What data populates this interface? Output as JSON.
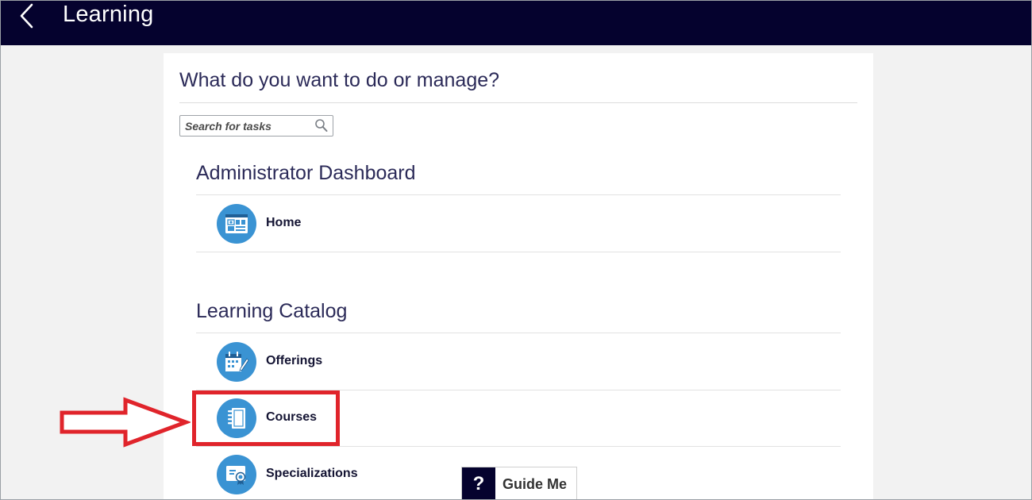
{
  "header": {
    "title": "Learning",
    "back_icon": "chevron-left-icon"
  },
  "main": {
    "question": "What do you want to do or manage?",
    "search": {
      "placeholder": "Search for tasks",
      "value": "",
      "icon": "search-icon"
    }
  },
  "sections": [
    {
      "title": "Administrator Dashboard",
      "items": [
        {
          "label": "Home",
          "icon": "dashboard-icon"
        }
      ]
    },
    {
      "title": "Learning Catalog",
      "items": [
        {
          "label": "Offerings",
          "icon": "calendar-edit-icon"
        },
        {
          "label": "Courses",
          "icon": "notebook-icon"
        },
        {
          "label": "Specializations",
          "icon": "certificate-icon"
        }
      ]
    }
  ],
  "guide": {
    "label": "Guide Me",
    "icon_text": "?"
  },
  "colors": {
    "header_bg": "#05022e",
    "icon_circle": "#3a93d3",
    "highlight": "#e0242b",
    "page_bg": "#f2f2f2"
  }
}
